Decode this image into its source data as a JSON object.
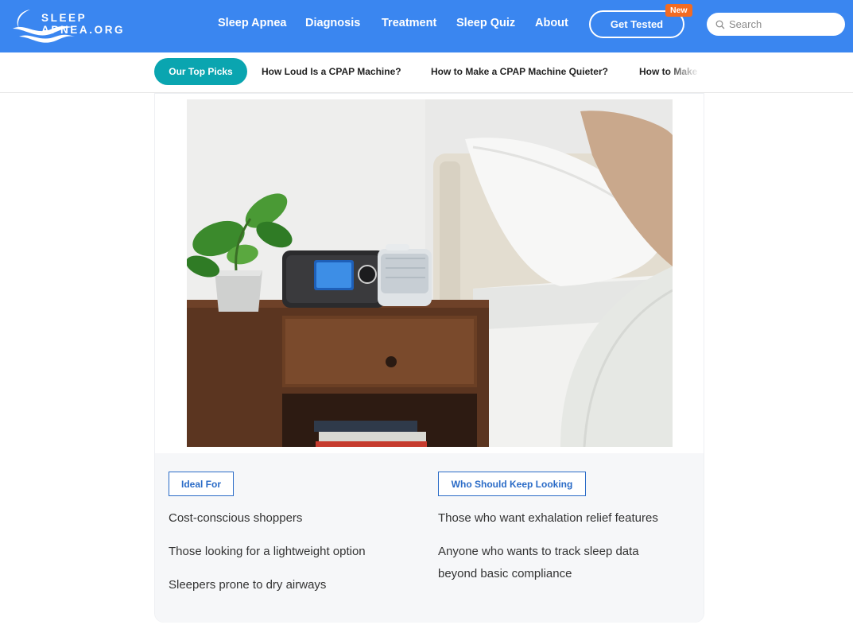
{
  "header": {
    "logo_text": "SLEEP APNEA.ORG",
    "nav": [
      "Sleep Apnea",
      "Diagnosis",
      "Treatment",
      "Sleep Quiz",
      "About"
    ],
    "cta_label": "Get Tested",
    "new_badge": "New",
    "search_placeholder": "Search",
    "brand_color": "#3a86f0"
  },
  "subnav": {
    "active": "Our Top Picks",
    "links": [
      "How Loud Is a CPAP Machine?",
      "How to Make a CPAP Machine Quieter?",
      "How to Make"
    ],
    "accent_color": "#0aa5b0"
  },
  "product": {
    "image_alt": "CPAP machine on bedside table"
  },
  "ideal_for": {
    "label": "Ideal For",
    "items": [
      "Cost-conscious shoppers",
      "Those looking for a lightweight option",
      "Sleepers prone to dry airways"
    ]
  },
  "keep_looking": {
    "label": "Who Should Keep Looking",
    "items": [
      "Those who want exhalation relief features",
      "Anyone who wants to track sleep data beyond basic compliance"
    ]
  }
}
